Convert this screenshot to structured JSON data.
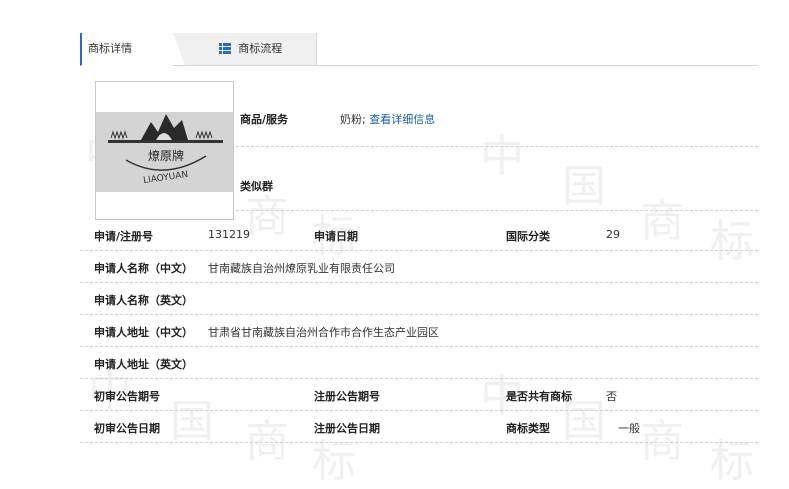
{
  "tabs": [
    {
      "label": "商标详情"
    },
    {
      "label": "商标流程"
    }
  ],
  "logo": {
    "script_text": "燎原牌",
    "latin_text": "LIAOYUAN"
  },
  "goods": {
    "label": "商品/服务",
    "value": "奶粉;",
    "link": "查看详细信息"
  },
  "similar_group": {
    "label": "类似群",
    "value": ""
  },
  "rows": {
    "reg_no_label": "申请/注册号",
    "reg_no": "131219",
    "apply_date_label": "申请日期",
    "apply_date": "",
    "intl_class_label": "国际分类",
    "intl_class": "29",
    "applicant_cn_label": "申请人名称（中文）",
    "applicant_cn": "甘南藏族自治州燎原乳业有限责任公司",
    "applicant_en_label": "申请人名称（英文）",
    "applicant_en": "",
    "address_cn_label": "申请人地址（中文）",
    "address_cn": "甘肃省甘南藏族自治州合作市合作生态产业园区",
    "address_en_label": "申请人地址（英文）",
    "address_en": "",
    "prelim_no_label": "初审公告期号",
    "prelim_no": "",
    "reg_notice_no_label": "注册公告期号",
    "reg_notice_no": "",
    "shared_label": "是否共有商标",
    "shared": "否",
    "prelim_date_label": "初审公告日期",
    "prelim_date": "",
    "reg_notice_date_label": "注册公告日期",
    "reg_notice_date": "",
    "type_label": "商标类型",
    "type": "一般"
  },
  "watermark": [
    "中",
    "国",
    "商",
    "标",
    "中",
    "国",
    "商",
    "标",
    "中",
    "国",
    "商",
    "标",
    "中",
    "国",
    "商",
    "标"
  ],
  "colors": {
    "accent": "#2a6cc2",
    "link": "#1f5fa8"
  }
}
